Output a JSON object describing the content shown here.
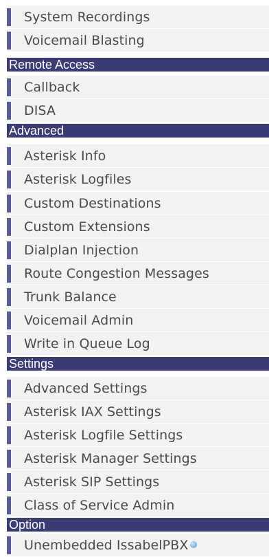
{
  "menu": {
    "sections": [
      {
        "header": null,
        "items": [
          {
            "label": "System Recordings"
          },
          {
            "label": "Voicemail Blasting"
          }
        ]
      },
      {
        "header": "Remote Access",
        "items": [
          {
            "label": "Callback"
          },
          {
            "label": "DISA"
          }
        ]
      },
      {
        "header": "Advanced",
        "items": [
          {
            "label": "Asterisk Info"
          },
          {
            "label": "Asterisk Logfiles"
          },
          {
            "label": "Custom Destinations"
          },
          {
            "label": "Custom Extensions"
          },
          {
            "label": "Dialplan Injection"
          },
          {
            "label": "Route Congestion Messages"
          },
          {
            "label": "Trunk Balance"
          },
          {
            "label": "Voicemail Admin"
          },
          {
            "label": "Write in Queue Log"
          }
        ]
      },
      {
        "header": "Settings",
        "items": [
          {
            "label": "Advanced Settings"
          },
          {
            "label": "Asterisk IAX Settings"
          },
          {
            "label": "Asterisk Logfile Settings"
          },
          {
            "label": "Asterisk Manager Settings"
          },
          {
            "label": "Asterisk SIP Settings"
          },
          {
            "label": "Class of Service Admin"
          }
        ]
      },
      {
        "header": "Option",
        "items": [
          {
            "label": "Unembedded IssabelPBX",
            "icon": "info-icon"
          }
        ]
      }
    ]
  },
  "colors": {
    "header_bg": "#3b3b75",
    "item_bg": "#f2f2f2",
    "item_bar": "#5b5c95",
    "item_text": "#4a4a4a"
  }
}
